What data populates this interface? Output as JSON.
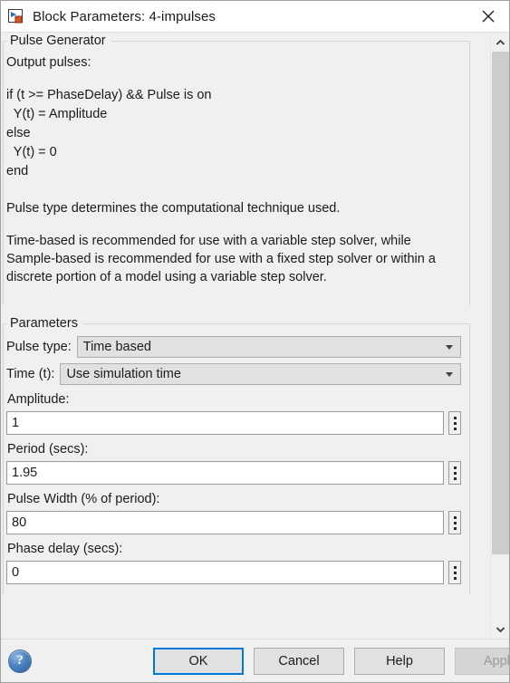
{
  "titlebar": {
    "title": "Block Parameters: 4-impulses",
    "icon": "simulink-block-icon",
    "close_icon": "close-icon"
  },
  "description_group": {
    "title": "Pulse Generator",
    "intro": "Output pulses:",
    "code": "if (t >= PhaseDelay) && Pulse is on\n  Y(t) = Amplitude\nelse\n  Y(t) = 0\nend",
    "paragraph1": "Pulse type determines the computational technique used.",
    "paragraph2": "Time-based is recommended for use with a variable step solver, while Sample-based is recommended for use with a fixed step solver or within a discrete portion of a model using a variable step solver."
  },
  "parameters_group": {
    "title": "Parameters",
    "pulse_type": {
      "label": "Pulse type:",
      "value": "Time based",
      "arrow_icon": "chevron-down-icon"
    },
    "time_source": {
      "label": "Time (t):",
      "value": "Use simulation time",
      "arrow_icon": "chevron-down-icon"
    },
    "fields": [
      {
        "label": "Amplitude:",
        "value": "1",
        "name": "amplitude"
      },
      {
        "label": "Period (secs):",
        "value": "1.95",
        "name": "period"
      },
      {
        "label": "Pulse Width (% of period):",
        "value": "80",
        "name": "pulse-width"
      },
      {
        "label": "Phase delay (secs):",
        "value": "0",
        "name": "phase-delay"
      }
    ],
    "spinner_icon": "vertical-dots-icon"
  },
  "scrollbar": {
    "up_icon": "chevron-up-icon",
    "down_icon": "chevron-down-icon"
  },
  "footer": {
    "help_icon": "question-mark-icon",
    "ok_label": "OK",
    "cancel_label": "Cancel",
    "help_label": "Help",
    "apply_label": "Apply"
  },
  "colors": {
    "accent": "#0078d7",
    "window_bg": "#f0f0f0",
    "field_bg": "#ffffff",
    "scroll_thumb": "#cdcdcd"
  }
}
